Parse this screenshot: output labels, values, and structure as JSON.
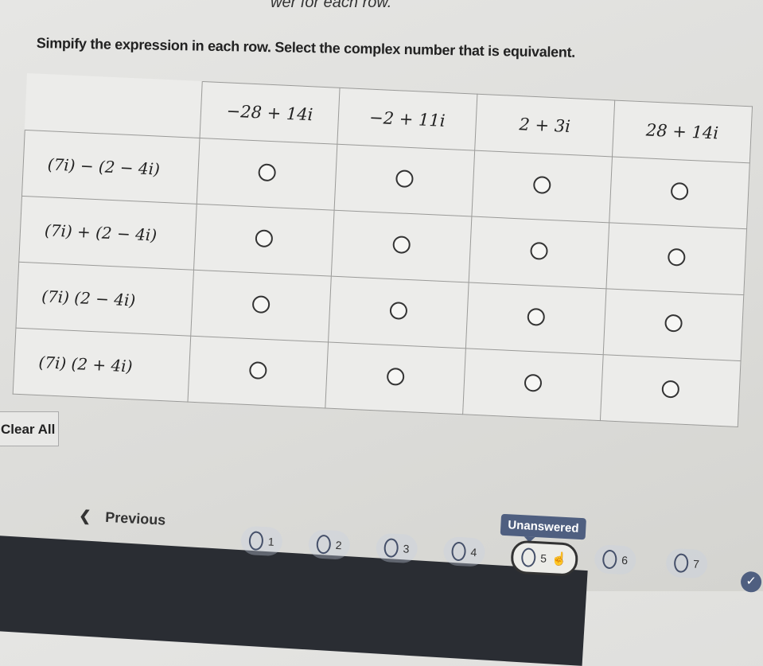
{
  "top_fragment": "wer for each row.",
  "instructions": "Simpify the expression in each row. Select the complex number that is equivalent.",
  "columns": [
    "−28 + 14i",
    "−2 + 11i",
    "2 + 3i",
    "28 + 14i"
  ],
  "rows": [
    {
      "expression": "(7i) − (2 − 4i)",
      "selected": null
    },
    {
      "expression": "(7i) + (2 − 4i)",
      "selected": null
    },
    {
      "expression": "(7i) (2 − 4i)",
      "selected": null
    },
    {
      "expression": "(7i) (2 + 4i)",
      "selected": null
    }
  ],
  "clear_all": "Clear All",
  "nav": {
    "previous": "Previous",
    "previous_icon": "chevron-left-icon",
    "questions": [
      "1",
      "2",
      "3",
      "4",
      "5",
      "6",
      "7"
    ],
    "current": "5",
    "tooltip": "Unanswered",
    "accent": "#4f5f80"
  }
}
